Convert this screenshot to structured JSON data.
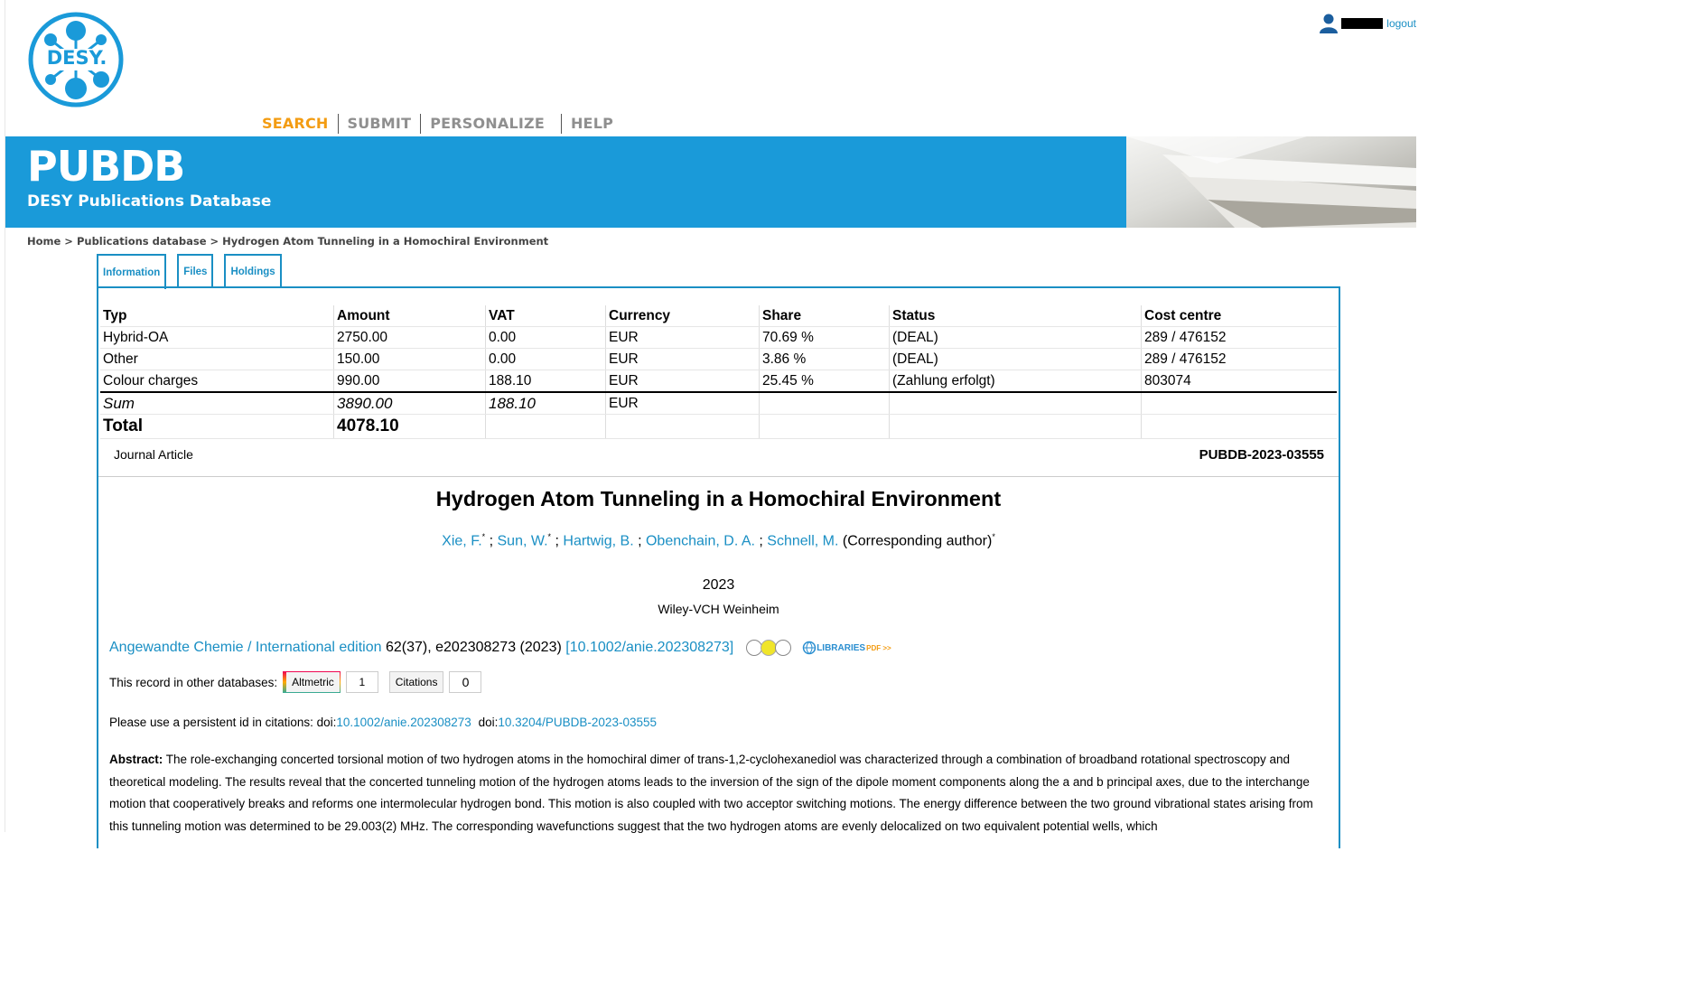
{
  "header": {
    "logo_text": "DESY.",
    "logout_label": "logout",
    "nav": [
      "SEARCH",
      "SUBMIT",
      "PERSONALIZE",
      "HELP"
    ],
    "brand": "PUBDB",
    "subtitle": "DESY Publications Database"
  },
  "breadcrumb": "Home > Publications database > Hydrogen Atom Tunneling in a Homochiral Environment",
  "tabs": [
    "Information",
    "Files",
    "Holdings"
  ],
  "costs": {
    "headers": [
      "Typ",
      "Amount",
      "VAT",
      "Currency",
      "Share",
      "Status",
      "Cost centre"
    ],
    "rows": [
      [
        "Hybrid-OA",
        "2750.00",
        "0.00",
        "EUR",
        "70.69 %",
        "(DEAL)",
        "289 / 476152"
      ],
      [
        "Other",
        "150.00",
        "0.00",
        "EUR",
        "3.86 %",
        "(DEAL)",
        "289 / 476152"
      ],
      [
        "Colour charges",
        "990.00",
        "188.10",
        "EUR",
        "25.45 %",
        "(Zahlung erfolgt)",
        "803074"
      ]
    ],
    "sum": {
      "label": "Sum",
      "amount": "3890.00",
      "vat": "188.10",
      "currency": "EUR"
    },
    "total": {
      "label": "Total",
      "amount": "4078.10"
    }
  },
  "record": {
    "type": "Journal Article",
    "id": "PUBDB-2023-03555",
    "title": "Hydrogen Atom Tunneling in a Homochiral Environment",
    "authors": [
      {
        "name": "Xie, F.",
        "mark": "*"
      },
      {
        "name": "Sun, W.",
        "mark": "*"
      },
      {
        "name": "Hartwig, B.",
        "mark": ""
      },
      {
        "name": "Obenchain, D. A.",
        "mark": ""
      },
      {
        "name": "Schnell, M.",
        "mark": ""
      }
    ],
    "corresponding": "(Corresponding author)",
    "corresponding_mark": "*",
    "year": "2023",
    "publisher": "Wiley-VCH Weinheim",
    "journal": "Angewandte Chemie / International edition",
    "citation": " 62(37), e202308273 (2023) ",
    "doi_link": "[10.1002/anie.202308273]",
    "libraries_label": "LIBRARIES",
    "libraries_suffix": "PDF >>",
    "other_db_label": "This record in other databases:",
    "altmetric_label": "Altmetric",
    "altmetric_count": "1",
    "citations_label": "Citations",
    "citations_count": "0",
    "persistent_label": "Please use a persistent id in citations: doi:",
    "persistent_doi1": "10.1002/anie.202308273",
    "persistent_doi_prefix2": "doi:",
    "persistent_doi2": "10.3204/PUBDB-2023-03555",
    "abstract_label": "Abstract:",
    "abstract_text": "The role-exchanging concerted torsional motion of two hydrogen atoms in the homochiral dimer of trans-1,2-cyclohexanediol was characterized through a combination of broadband rotational spectroscopy and theoretical modeling. The results reveal that the concerted tunneling motion of the hydrogen atoms leads to the inversion of the sign of the dipole moment components along the a and b principal axes, due to the interchange motion that cooperatively breaks and reforms one intermolecular hydrogen bond. This motion is also coupled with two acceptor switching motions. The energy difference between the two ground vibrational states arising from this tunneling motion was determined to be 29.003(2) MHz. The corresponding wavefunctions suggest that the two hydrogen atoms are evenly delocalized on two equivalent potential wells, which"
  },
  "colors": {
    "accent": "#1a9ad9",
    "link": "#1a8fc4",
    "nav_active": "#f39c12"
  }
}
